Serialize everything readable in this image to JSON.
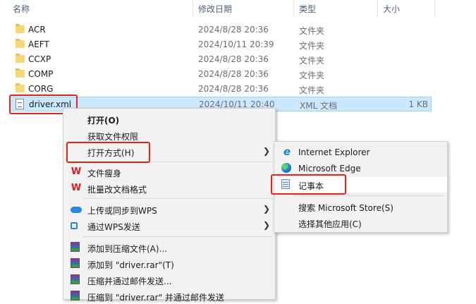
{
  "columns": {
    "name": "名称",
    "date": "修改日期",
    "type": "类型",
    "size": "大小"
  },
  "files": [
    {
      "name": "ACR",
      "date": "2024/8/28 20:36",
      "type": "文件夹",
      "size": ""
    },
    {
      "name": "AEFT",
      "date": "2024/10/11 20:39",
      "type": "文件夹",
      "size": ""
    },
    {
      "name": "CCXP",
      "date": "2024/8/28 20:36",
      "type": "文件夹",
      "size": ""
    },
    {
      "name": "COMP",
      "date": "2024/8/28 20:36",
      "type": "文件夹",
      "size": ""
    },
    {
      "name": "CORG",
      "date": "2024/8/28 20:36",
      "type": "文件夹",
      "size": ""
    },
    {
      "name": "driver.xml",
      "date": "2024/10/11 20:40",
      "type": "XML 文档",
      "size": "1 KB"
    }
  ],
  "context_menu": {
    "open": "打开(O)",
    "take_ownership": "获取文件权限",
    "open_with": "打开方式(H)",
    "wps_slim": "文件瘦身",
    "wps_batch": "批量改文档格式",
    "wps_upload": "上传或同步到WPS",
    "wps_send": "通过WPS发送",
    "rar_add": "添加到压缩文件(A)...",
    "rar_add_named": "添加到 \"driver.rar\"(T)",
    "rar_email": "压缩并通过邮件发送...",
    "rar_named_email": "压缩到 \"driver.rar\" 并通过邮件发送"
  },
  "open_with_menu": {
    "ie": "Internet Explorer",
    "edge": "Microsoft Edge",
    "notepad": "记事本",
    "store": "搜索 Microsoft Store(S)",
    "other": "选择其他应用(C)"
  },
  "colors": {
    "highlight": "#e0241c",
    "selection": "#cce8ff",
    "folder": "#f8d775"
  }
}
